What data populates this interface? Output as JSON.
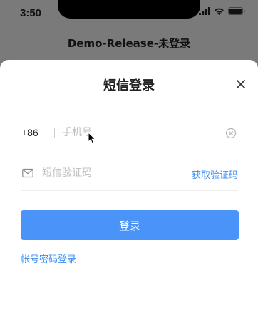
{
  "status_bar": {
    "time": "3:50",
    "icons": [
      "signal-icon",
      "wifi-icon",
      "battery-icon"
    ]
  },
  "nav": {
    "title": "Demo-Release-未登录"
  },
  "sheet": {
    "title": "短信登录",
    "close_icon": "close-icon",
    "phone": {
      "country_code": "+86",
      "value": "",
      "placeholder": "手机号",
      "clear_icon": "clear-icon"
    },
    "sms_code": {
      "icon": "mail-icon",
      "value": "",
      "placeholder": "短信验证码",
      "get_code_label": "获取验证码"
    },
    "login_button_label": "登录",
    "password_login_label": "帐号密码登录"
  },
  "colors": {
    "accent": "#3f8ef5",
    "primary_button": "#4a93f8",
    "backdrop": "#7a7a7a",
    "sheet": "#ffffff"
  }
}
